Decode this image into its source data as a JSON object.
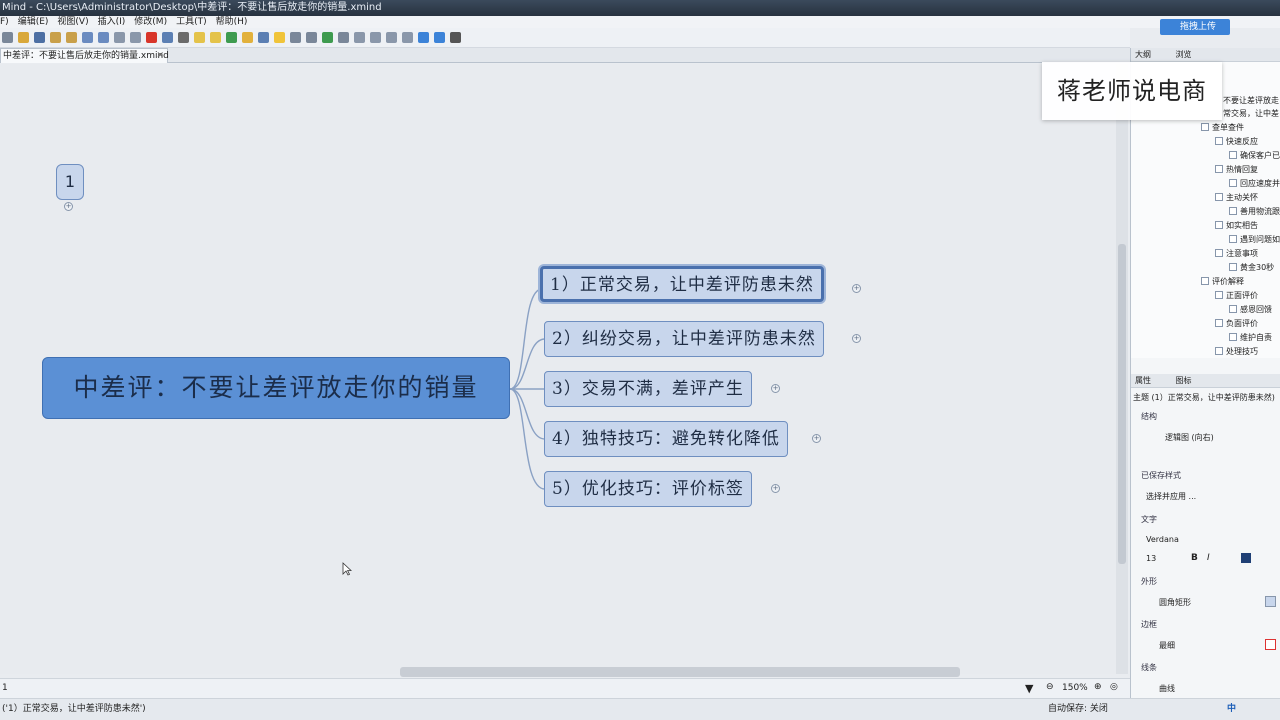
{
  "window": {
    "title": "Mind - C:\\Users\\Administrator\\Desktop\\中差评：不要让售后放走你的销量.xmind"
  },
  "menu": [
    "F)",
    "编辑(E)",
    "视图(V)",
    "插入(I)",
    "修改(M)",
    "工具(T)",
    "帮助(H)"
  ],
  "upload_label": "拖拽上传",
  "tab": {
    "label": "中差评：不要让售后放走你的销量.xmind",
    "close": "✕"
  },
  "canvas": {
    "floating_label": "1",
    "central_topic": "中差评：不要让差评放走你的销量",
    "branches": [
      "1）正常交易，让中差评防患未然",
      "2）纠纷交易，让中差评防患未然",
      "3）交易不满，差评产生",
      "4）独特技巧：避免转化降低",
      "5）优化技巧：评价标签"
    ]
  },
  "watermark": "蒋老师说电商",
  "outline": {
    "tabs": [
      "大纲",
      "浏览"
    ],
    "items": [
      "不要让差评放走",
      "常交易，让中差",
      "查单查件",
      "快速反应",
      "确保客户已",
      "热情回复",
      "回应速度并",
      "主动关怀",
      "善用物流跟",
      "如实相告",
      "遇到问题如",
      "注意事项",
      "黄金30秒",
      "评价解释",
      "正面评价",
      "感恩回馈",
      "负面评价",
      "维护自责",
      "处理技巧"
    ]
  },
  "properties": {
    "tabs": [
      "属性",
      "图标"
    ],
    "subject": "主题 (1）正常交易，让中差评防患未然)",
    "structure_title": "结构",
    "structure_value": "逻辑图 (向右)",
    "saved_style_title": "已保存样式",
    "saved_style_value": "选择并应用 ...",
    "text_title": "文字",
    "font_name": "Verdana",
    "font_size": "13",
    "shape_title": "外形",
    "shape_value": "圆角矩形",
    "border_title": "边框",
    "border_value": "最细",
    "line_title": "线条",
    "line_value": "曲线"
  },
  "status": {
    "zoom": "150%",
    "left_num": "1",
    "selection_text": "('1）正常交易，让中差评防患未然')",
    "autosave": "自动保存: 关闭",
    "ime": "中"
  },
  "colors": {
    "central_fill": "#5b90d5",
    "branch_fill": "#c8d6ec",
    "branch_border": "#6f8fc0",
    "selected_border": "#4a70ad"
  }
}
